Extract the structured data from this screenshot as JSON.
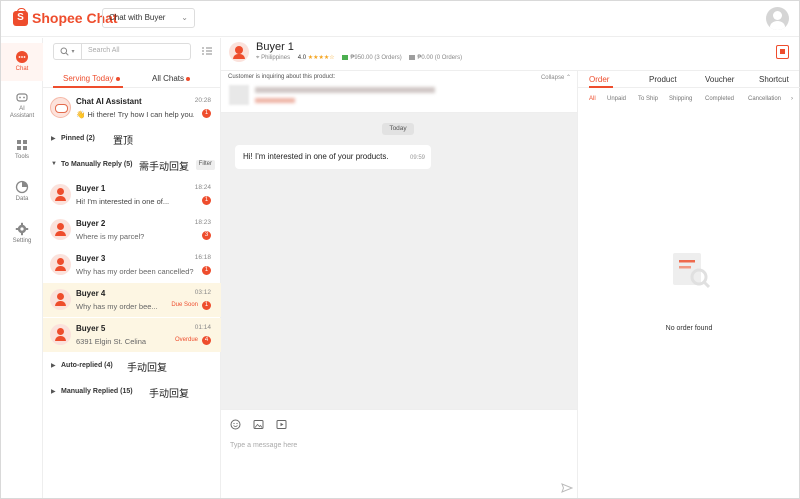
{
  "app": {
    "brand": "Shopee Chat",
    "mode_select": "Chat with Buyer"
  },
  "rail": [
    {
      "label": "Chat",
      "icon": "chat-bubble-icon",
      "active": true
    },
    {
      "label": "AI Assistant",
      "icon": "ai-bot-icon",
      "active": false
    },
    {
      "label": "Tools",
      "icon": "grid-tools-icon",
      "active": false
    },
    {
      "label": "Data",
      "icon": "chart-data-icon",
      "active": false
    },
    {
      "label": "Setting",
      "icon": "gear-icon",
      "active": false
    }
  ],
  "chat_list": {
    "search_placeholder": "Search All",
    "tabs": [
      {
        "label": "Serving Today",
        "active": true
      },
      {
        "label": "All Chats",
        "active": false
      }
    ],
    "ai_assistant": {
      "name": "Chat AI Assistant",
      "message": "👋 Hi there! Try how I can help you...",
      "time": "20:28",
      "badge": "1"
    },
    "pinned": {
      "label": "Pinned (2)",
      "note": "置顶"
    },
    "manual": {
      "label": "To Manually Reply (5)",
      "note": "需手动回复",
      "filter": "Filter"
    },
    "rows": [
      {
        "name": "Buyer 1",
        "message": "Hi! I'm interested in one of...",
        "time": "18:24",
        "badge": "1",
        "status": "",
        "highlight": false
      },
      {
        "name": "Buyer 2",
        "message": "Where is my parcel?",
        "time": "18:23",
        "badge": "3",
        "status": "",
        "highlight": false
      },
      {
        "name": "Buyer 3",
        "message": "Why has my order been cancelled?",
        "time": "16:18",
        "badge": "1",
        "status": "",
        "highlight": false
      },
      {
        "name": "Buyer 4",
        "message": "Why has my order bee...",
        "time": "03:12",
        "badge": "1",
        "status": "Due Soon",
        "highlight": true
      },
      {
        "name": "Buyer 5",
        "message": "6391 Elgin St. Celina",
        "time": "01:14",
        "badge": "4",
        "status": "Overdue",
        "highlight": true
      }
    ],
    "auto_replied": {
      "label": "Auto-replied (4)",
      "note": "手动回复"
    },
    "manually_replied": {
      "label": "Manually Replied (15)",
      "note": "手动回复"
    }
  },
  "conversation": {
    "name": "Buyer 1",
    "country": "Philippines",
    "rating": "4.0",
    "stars": "★★★★☆",
    "orders_total": "₱950.00 (3 Orders)",
    "orders_other": "₱0.00 (0 Orders)",
    "inquiry_label": "Customer is inquiring about this product:",
    "collapse": "Collapse",
    "date_chip": "Today",
    "messages": [
      {
        "text": "Hi! I'm interested in one of your products.",
        "time": "09:59"
      }
    ],
    "composer_placeholder": "Type a message here"
  },
  "orders_panel": {
    "tabs": [
      {
        "label": "Order",
        "active": true
      },
      {
        "label": "Product",
        "active": false
      },
      {
        "label": "Voucher",
        "active": false
      },
      {
        "label": "Shortcut",
        "active": false
      }
    ],
    "subtabs": [
      {
        "label": "All",
        "active": true
      },
      {
        "label": "Unpaid",
        "active": false
      },
      {
        "label": "To Ship",
        "active": false
      },
      {
        "label": "Shipping",
        "active": false
      },
      {
        "label": "Completed",
        "active": false
      },
      {
        "label": "Cancellation",
        "active": false
      }
    ],
    "empty_text": "No order found"
  },
  "colors": {
    "accent": "#ee4d2d",
    "highlight_row": "#fdf6e3",
    "chat_bg": "#f0f0f0"
  }
}
